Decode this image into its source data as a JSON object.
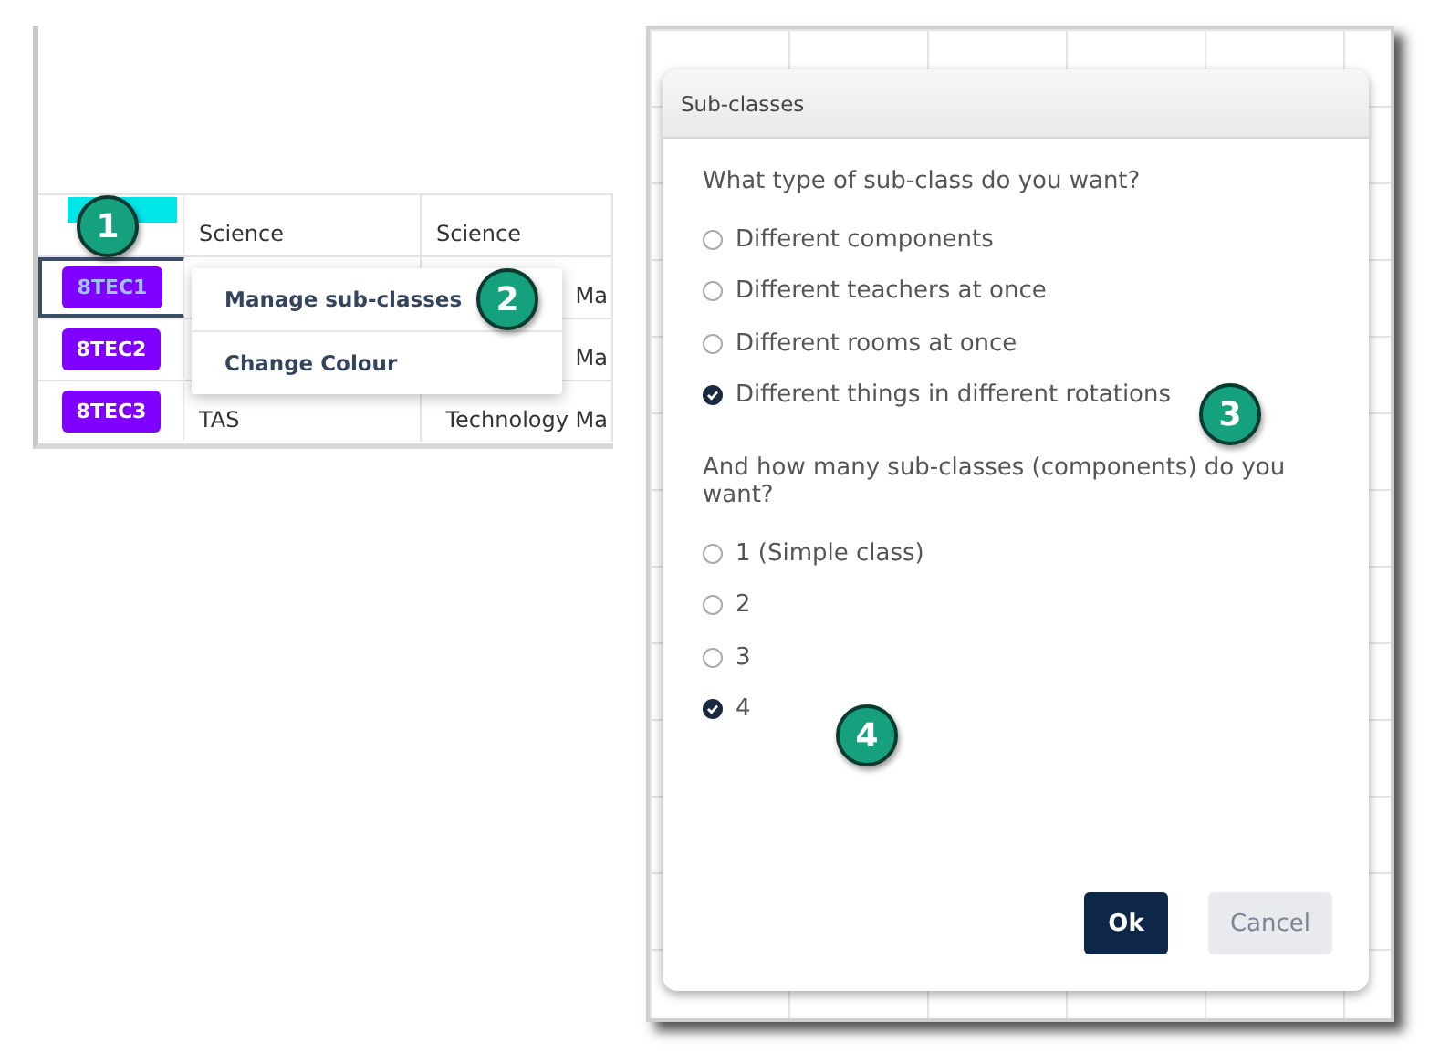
{
  "table": {
    "rows": [
      {
        "class": "",
        "column_2": "Science",
        "column_3": "Science",
        "selected": false
      },
      {
        "class": "8TEC1",
        "column_2": "",
        "column_3": "Ma",
        "selected": true
      },
      {
        "class": "8TEC2",
        "column_2": "",
        "column_3": "Ma",
        "selected": false
      },
      {
        "class": "8TEC3",
        "column_2": "TAS",
        "column_3": "Technology Ma",
        "selected": false
      }
    ]
  },
  "context_menu": {
    "items": [
      "Manage sub-classes",
      "Change Colour"
    ]
  },
  "dialog": {
    "title": "Sub-classes",
    "question_1": "What type of sub-class do you want?",
    "type_options": [
      {
        "label": "Different components",
        "selected": false
      },
      {
        "label": "Different teachers at once",
        "selected": false
      },
      {
        "label": "Different rooms at once",
        "selected": false
      },
      {
        "label": "Different things in different rotations",
        "selected": true
      }
    ],
    "question_2": "And how many sub-classes (components) do you want?",
    "count_options": [
      {
        "label": "1 (Simple class)",
        "selected": false
      },
      {
        "label": "2",
        "selected": false
      },
      {
        "label": "3",
        "selected": false
      },
      {
        "label": "4",
        "selected": true
      }
    ],
    "buttons": [
      {
        "label": "Ok",
        "kind": "primary"
      },
      {
        "label": "Cancel",
        "kind": "secondary"
      }
    ]
  },
  "callouts": [
    "1",
    "2",
    "3",
    "4"
  ]
}
